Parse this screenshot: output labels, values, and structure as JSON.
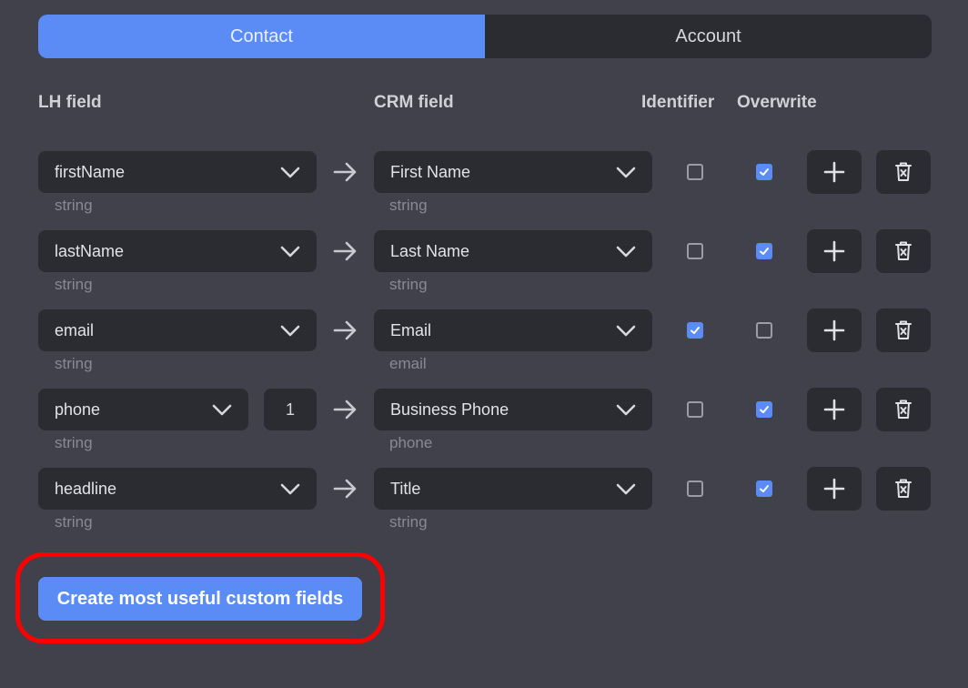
{
  "tabs": [
    {
      "label": "Contact",
      "active": true
    },
    {
      "label": "Account",
      "active": false
    }
  ],
  "headers": {
    "lh_field": "LH field",
    "crm_field": "CRM field",
    "identifier": "Identifier",
    "overwrite": "Overwrite"
  },
  "rows": [
    {
      "lh": "firstName",
      "lh_type": "string",
      "crm": "First Name",
      "crm_type": "string",
      "identifier": false,
      "overwrite": true
    },
    {
      "lh": "lastName",
      "lh_type": "string",
      "crm": "Last Name",
      "crm_type": "string",
      "identifier": false,
      "overwrite": true
    },
    {
      "lh": "email",
      "lh_type": "string",
      "crm": "Email",
      "crm_type": "email",
      "identifier": true,
      "overwrite": false
    },
    {
      "lh": "phone",
      "lh_index": "1",
      "lh_type": "string",
      "crm": "Business Phone",
      "crm_type": "phone",
      "identifier": false,
      "overwrite": true
    },
    {
      "lh": "headline",
      "lh_type": "string",
      "crm": "Title",
      "crm_type": "string",
      "identifier": false,
      "overwrite": true
    }
  ],
  "cta_label": "Create most useful custom fields",
  "colors": {
    "accent": "#5b8cf6",
    "background": "#40414a",
    "surface": "#2b2c31",
    "highlight": "#ff0000"
  },
  "icons": {
    "dropdown": "chevron-down-icon",
    "mapping": "arrow-right-icon",
    "add": "plus-icon",
    "delete": "trash-icon",
    "checked": "check-icon"
  }
}
